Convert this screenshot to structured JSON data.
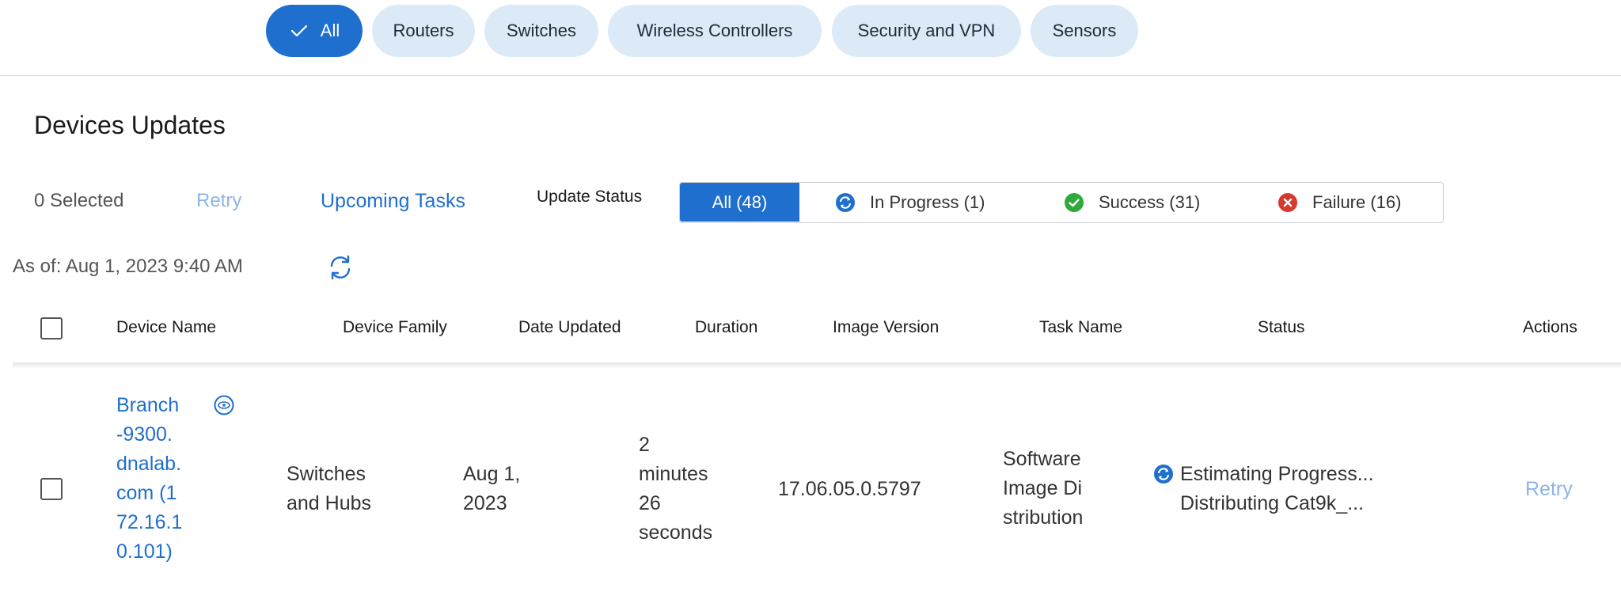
{
  "filters": {
    "chips": [
      {
        "label": "All",
        "active": true
      },
      {
        "label": "Routers",
        "active": false
      },
      {
        "label": "Switches",
        "active": false
      },
      {
        "label": "Wireless Controllers",
        "active": false
      },
      {
        "label": "Security and VPN",
        "active": false
      },
      {
        "label": "Sensors",
        "active": false
      }
    ]
  },
  "section": {
    "title": "Devices Updates"
  },
  "toolbar": {
    "selected_text": "0 Selected",
    "retry_label": "Retry",
    "upcoming_label": "Upcoming Tasks",
    "status_label": "Update Status",
    "status_filters": {
      "all": "All (48)",
      "in_progress": "In Progress (1)",
      "success": "Success (31)",
      "failure": "Failure (16)"
    }
  },
  "as_of": "As of: Aug 1, 2023 9:40 AM",
  "table": {
    "columns": {
      "device_name": "Device Name",
      "device_family": "Device Family",
      "date_updated": "Date Updated",
      "duration": "Duration",
      "image_version": "Image Version",
      "task_name": "Task Name",
      "status": "Status",
      "actions": "Actions"
    },
    "rows": [
      {
        "device_name_lines": [
          "Branch",
          "-9300.",
          "dnalab.",
          "com (1",
          "72.16.1",
          "0.101)"
        ],
        "device_family_lines": [
          "Switches",
          "and Hubs"
        ],
        "date_updated_lines": [
          "Aug 1,",
          "2023"
        ],
        "duration_lines": [
          "2",
          "minutes",
          "26",
          "seconds"
        ],
        "image_version": "17.06.05.0.5797",
        "task_name_lines": [
          "Software",
          "Image Di",
          "stribution"
        ],
        "status_lines": [
          "Estimating Progress...",
          "Distributing Cat9k_..."
        ],
        "action": "Retry"
      }
    ]
  },
  "colors": {
    "accent": "#1f6fcf",
    "chip_bg": "#dce9f7",
    "success": "#2eaa3a",
    "failure": "#d43b2e",
    "link_disabled": "#8db4e6"
  },
  "icons": {
    "check": "check-icon",
    "in_progress": "sync-icon",
    "success": "check-circle-icon",
    "failure": "x-circle-icon",
    "refresh": "refresh-icon",
    "device_360": "360-view-icon"
  }
}
